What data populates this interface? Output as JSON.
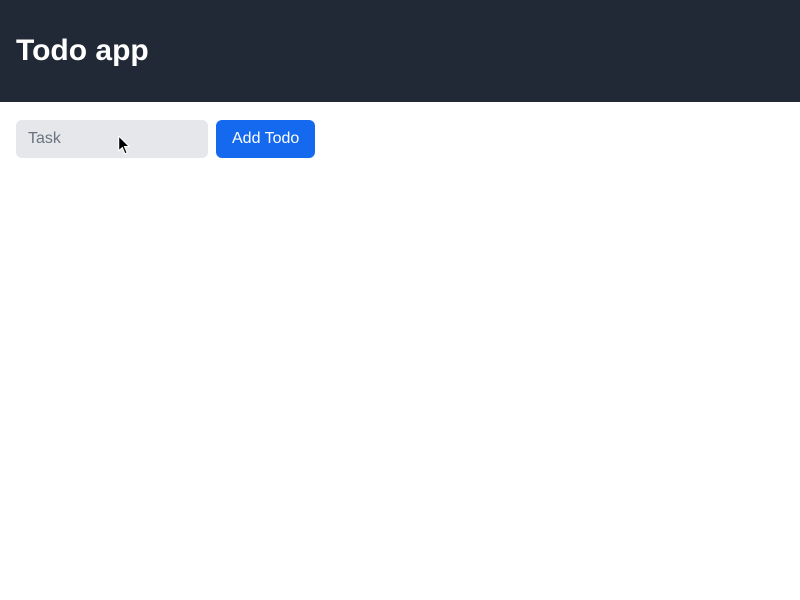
{
  "header": {
    "title": "Todo app"
  },
  "form": {
    "task_input_placeholder": "Task",
    "task_input_value": "",
    "add_button_label": "Add Todo"
  }
}
